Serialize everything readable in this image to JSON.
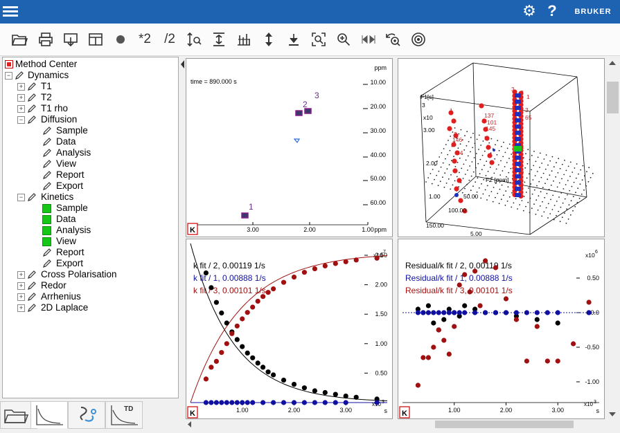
{
  "header": {
    "logo": "BRUKER",
    "help": "?"
  },
  "toolbar": {
    "items": [
      {
        "name": "open-icon",
        "glyph": ""
      },
      {
        "name": "print-icon",
        "glyph": ""
      },
      {
        "name": "export-icon",
        "glyph": ""
      },
      {
        "name": "layout-icon",
        "glyph": ""
      },
      {
        "name": "dot-icon",
        "glyph": "●"
      },
      {
        "name": "multiply-2-button",
        "glyph": "*2"
      },
      {
        "name": "divide-2-button",
        "glyph": "/2"
      }
    ]
  },
  "tree": {
    "root": "Method Center",
    "dynamics": "Dynamics",
    "t1": "T1",
    "t2": "T2",
    "t1rho": "T1 rho",
    "diffusion": "Diffusion",
    "diffusion_children": [
      "Sample",
      "Data",
      "Analysis",
      "View",
      "Report",
      "Export"
    ],
    "kinetics": "Kinetics",
    "kinetics_children": [
      "Sample",
      "Data",
      "Analysis",
      "View",
      "Report",
      "Export"
    ],
    "others": [
      "Cross Polarisation",
      "Redor",
      "Arrhenius",
      "2D Laplace"
    ]
  },
  "bottom_tabs": {
    "td": "TD"
  },
  "panel_2d": {
    "time_label": "time = 890.000 s",
    "y_unit": "ppm",
    "y_ticks": [
      "10.00",
      "20.00",
      "30.00",
      "40.00",
      "50.00",
      "60.00"
    ],
    "x_ticks": [
      "3.00",
      "2.00",
      "1.00"
    ],
    "x_unit": "ppm",
    "peak_labels": [
      "1",
      "2",
      "3"
    ],
    "k_label": "K"
  },
  "panel_3d": {
    "f1_label": "F1[s]",
    "f1_sub": "3",
    "x10": "x10",
    "z_ticks": [
      "3.00",
      "2.00",
      "1.00"
    ],
    "f2_label": "F2 [ppm]",
    "axis_ticks": [
      "50.00",
      "100.00",
      "150.00",
      "5.00"
    ],
    "peak_labels": [
      "3",
      "3",
      "1",
      "137",
      "101",
      "145",
      "3",
      "34",
      "146",
      "1",
      "3",
      "65",
      "1"
    ]
  },
  "panel_fit": {
    "legend": [
      {
        "text": "k fit / 2,  0.00119 1/s",
        "color": "#000000"
      },
      {
        "text": "k fit / 1,  0.00888 1/s",
        "color": "#1010a0"
      },
      {
        "text": "k fit / 3,  0.00101 1/s",
        "color": "#a01010"
      }
    ],
    "y_exp": "x10",
    "y_exp_power": "7",
    "y_ticks": [
      "2.50",
      "2.00",
      "1.50",
      "1.00",
      "0.50"
    ],
    "x_ticks": [
      "1.00",
      "2.00",
      "3.00"
    ],
    "x_exp": "x10",
    "x_exp_power": "3",
    "x_unit": "s",
    "k_label": "K"
  },
  "panel_resid": {
    "legend": [
      {
        "text": "Residual/k fit / 2,  0.00119 1/s",
        "color": "#000000"
      },
      {
        "text": "Residual/k fit / 1,  0.00888 1/s",
        "color": "#1010a0"
      },
      {
        "text": "Residual/k fit / 3,  0.00101 1/s",
        "color": "#a01010"
      }
    ],
    "y_exp": "x10",
    "y_exp_power": "6",
    "y_ticks": [
      "0.50",
      "0.0",
      "-0.50",
      "-1.00"
    ],
    "x_ticks": [
      "1.00",
      "2.00",
      "3.00"
    ],
    "x_exp": "x10",
    "x_exp_power": "3",
    "x_unit": "s",
    "k_label": "K"
  },
  "chart_data": [
    {
      "type": "scatter",
      "title": "k fit",
      "xlabel": "s",
      "ylabel": "",
      "xlim": [
        0,
        3800
      ],
      "ylim": [
        0,
        27000000
      ],
      "series": [
        {
          "name": "k fit / 2,  0.00119 1/s",
          "color": "#000000",
          "x": [
            300,
            400,
            500,
            600,
            700,
            800,
            900,
            1000,
            1100,
            1200,
            1300,
            1400,
            1500,
            1600,
            1800,
            2000,
            2200,
            2400,
            2600,
            2800,
            3000,
            3200,
            3600
          ],
          "y": [
            22000000,
            19500000,
            17000000,
            15200000,
            13500000,
            12000000,
            10700000,
            9500000,
            8400000,
            7600000,
            6700000,
            6000000,
            5200000,
            4700000,
            3800000,
            3100000,
            2500000,
            2000000,
            1700000,
            1400000,
            1100000,
            900000,
            600000
          ]
        },
        {
          "name": "k fit / 1,  0.00888 1/s",
          "color": "#1010a0",
          "x": [
            300,
            400,
            500,
            600,
            700,
            800,
            900,
            1000,
            1100,
            1200,
            1400,
            1600,
            1800,
            2000,
            2200,
            2400,
            2600,
            2800,
            3000,
            3600
          ],
          "y": [
            0,
            0,
            0,
            0,
            0,
            0,
            0,
            0,
            0,
            0,
            0,
            0,
            0,
            0,
            0,
            0,
            0,
            0,
            0,
            0
          ]
        },
        {
          "name": "k fit / 3,  0.00101 1/s",
          "color": "#a01010",
          "x": [
            300,
            400,
            500,
            600,
            700,
            800,
            900,
            1000,
            1100,
            1200,
            1300,
            1400,
            1500,
            1600,
            1800,
            2000,
            2200,
            2400,
            2600,
            2800,
            3000,
            3200,
            3600
          ],
          "y": [
            4000000,
            6000000,
            7000000,
            8500000,
            10000000,
            11700000,
            13000000,
            14200000,
            15300000,
            16200000,
            17200000,
            18000000,
            18700000,
            19300000,
            20400000,
            21300000,
            22100000,
            22700000,
            23200000,
            23600000,
            23900000,
            24200000,
            24500000
          ]
        }
      ]
    },
    {
      "type": "scatter",
      "title": "Residual",
      "xlabel": "s",
      "ylabel": "",
      "xlim": [
        0,
        3800
      ],
      "ylim": [
        -1300000,
        1000000
      ],
      "series": [
        {
          "name": "Residual/k fit / 2,  0.00119 1/s",
          "color": "#000000",
          "x": [
            300,
            400,
            500,
            600,
            700,
            800,
            900,
            1000,
            1100,
            1200,
            1400,
            1600,
            1800,
            2000,
            2200,
            2600,
            3000,
            3600
          ],
          "y": [
            50000,
            0,
            100000,
            -150000,
            -250000,
            -100000,
            50000,
            0,
            -50000,
            100000,
            50000,
            0,
            0,
            0,
            -50000,
            -100000,
            -150000,
            0
          ]
        },
        {
          "name": "Residual/k fit / 1,  0.00888 1/s",
          "color": "#1010a0",
          "x": [
            300,
            400,
            500,
            600,
            700,
            800,
            900,
            1000,
            1100,
            1200,
            1400,
            1600,
            1800,
            2000,
            2200,
            2400,
            2600,
            2800,
            3000,
            3600
          ],
          "y": [
            0,
            0,
            0,
            0,
            0,
            0,
            0,
            0,
            0,
            0,
            0,
            0,
            0,
            0,
            0,
            0,
            0,
            0,
            0,
            0
          ]
        },
        {
          "name": "Residual/k fit / 3,  0.00101 1/s",
          "color": "#a01010",
          "x": [
            300,
            400,
            500,
            600,
            700,
            800,
            900,
            1000,
            1100,
            1200,
            1300,
            1400,
            1500,
            1600,
            1800,
            2000,
            2200,
            2400,
            2600,
            2800,
            3000,
            3300,
            3600
          ],
          "y": [
            -1050000,
            -650000,
            -650000,
            -500000,
            -250000,
            -400000,
            -600000,
            -200000,
            400000,
            550000,
            300000,
            600000,
            100000,
            750000,
            650000,
            200000,
            -100000,
            -700000,
            -200000,
            -700000,
            -700000,
            -450000,
            150000
          ]
        }
      ]
    }
  ]
}
